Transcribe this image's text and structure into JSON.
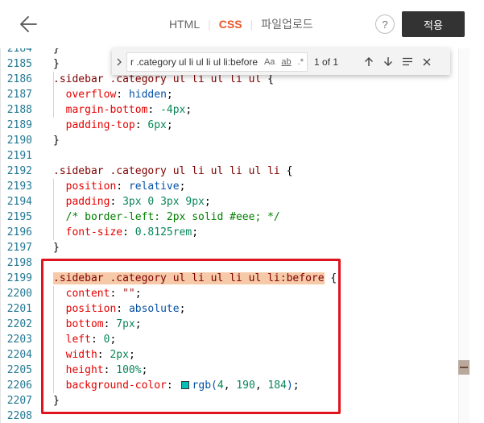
{
  "header": {
    "back_icon": "arrow-left-icon",
    "tabs": [
      {
        "label": "HTML",
        "active": false
      },
      {
        "label": "CSS",
        "active": true
      },
      {
        "label": "파일업로드",
        "active": false
      }
    ],
    "separator": "|",
    "help_label": "?",
    "apply_label": "적용"
  },
  "find": {
    "query": "r .category ul li ul li ul li:before",
    "match_case": "Aa",
    "whole_word": "ab",
    "regex": ".*",
    "count": "1 of 1",
    "icons": {
      "toggle": "chevron-right-icon",
      "prev": "arrow-up-icon",
      "next": "arrow-down-icon",
      "selection": "find-in-selection-icon",
      "close": "close-icon"
    }
  },
  "editor": {
    "colors": {
      "selector": "#800000",
      "property": "#e50000",
      "value": "#0451a5",
      "number": "#098658",
      "comment": "#008000",
      "line_number": "#237893",
      "highlight_box": "#e0141e",
      "swatch": "#04beb8"
    },
    "lines": [
      {
        "n": "2184",
        "tokens": [
          {
            "t": "}",
            "c": "punc"
          }
        ]
      },
      {
        "n": "2185",
        "tokens": [
          {
            "t": "}",
            "c": "punc"
          }
        ]
      },
      {
        "n": "2186",
        "tokens": [
          {
            "t": ".sidebar .category ul li ul li ul",
            "c": "sel"
          },
          {
            "t": " {",
            "c": "punc"
          }
        ]
      },
      {
        "n": "2187",
        "tokens": [
          {
            "t": "  "
          },
          {
            "t": "overflow",
            "c": "prop"
          },
          {
            "t": ": ",
            "c": "punc"
          },
          {
            "t": "hidden",
            "c": "val"
          },
          {
            "t": ";",
            "c": "punc"
          }
        ]
      },
      {
        "n": "2188",
        "tokens": [
          {
            "t": "  "
          },
          {
            "t": "margin-bottom",
            "c": "prop"
          },
          {
            "t": ": ",
            "c": "punc"
          },
          {
            "t": "-4px",
            "c": "num"
          },
          {
            "t": ";",
            "c": "punc"
          }
        ]
      },
      {
        "n": "2189",
        "tokens": [
          {
            "t": "  "
          },
          {
            "t": "padding-top",
            "c": "prop"
          },
          {
            "t": ": ",
            "c": "punc"
          },
          {
            "t": "6px",
            "c": "num"
          },
          {
            "t": ";",
            "c": "punc"
          }
        ]
      },
      {
        "n": "2190",
        "tokens": [
          {
            "t": "}",
            "c": "punc"
          }
        ]
      },
      {
        "n": "2191",
        "tokens": []
      },
      {
        "n": "2192",
        "tokens": [
          {
            "t": ".sidebar .category ul li ul li ul li",
            "c": "sel"
          },
          {
            "t": " {",
            "c": "punc"
          }
        ]
      },
      {
        "n": "2193",
        "tokens": [
          {
            "t": "  "
          },
          {
            "t": "position",
            "c": "prop"
          },
          {
            "t": ": ",
            "c": "punc"
          },
          {
            "t": "relative",
            "c": "val"
          },
          {
            "t": ";",
            "c": "punc"
          }
        ]
      },
      {
        "n": "2194",
        "tokens": [
          {
            "t": "  "
          },
          {
            "t": "padding",
            "c": "prop"
          },
          {
            "t": ": ",
            "c": "punc"
          },
          {
            "t": "3px 0 3px 9px",
            "c": "num"
          },
          {
            "t": ";",
            "c": "punc"
          }
        ]
      },
      {
        "n": "2195",
        "tokens": [
          {
            "t": "  "
          },
          {
            "t": "/* border-left: 2px solid #eee; */",
            "c": "cmt"
          }
        ]
      },
      {
        "n": "2196",
        "tokens": [
          {
            "t": "  "
          },
          {
            "t": "font-size",
            "c": "prop"
          },
          {
            "t": ": ",
            "c": "punc"
          },
          {
            "t": "0.8125rem",
            "c": "num"
          },
          {
            "t": ";",
            "c": "punc"
          }
        ]
      },
      {
        "n": "2197",
        "tokens": [
          {
            "t": "}",
            "c": "punc"
          }
        ]
      },
      {
        "n": "2198",
        "tokens": []
      },
      {
        "n": "2199",
        "tokens": [
          {
            "t": ".sidebar .category ul li ul li ul li:before",
            "c": "sel",
            "hl": true
          },
          {
            "t": " {",
            "c": "punc"
          }
        ]
      },
      {
        "n": "2200",
        "tokens": [
          {
            "t": "  "
          },
          {
            "t": "content",
            "c": "prop"
          },
          {
            "t": ": ",
            "c": "punc"
          },
          {
            "t": "\"\"",
            "c": "str"
          },
          {
            "t": ";",
            "c": "punc"
          }
        ]
      },
      {
        "n": "2201",
        "tokens": [
          {
            "t": "  "
          },
          {
            "t": "position",
            "c": "prop"
          },
          {
            "t": ": ",
            "c": "punc"
          },
          {
            "t": "absolute",
            "c": "val"
          },
          {
            "t": ";",
            "c": "punc"
          }
        ]
      },
      {
        "n": "2202",
        "tokens": [
          {
            "t": "  "
          },
          {
            "t": "bottom",
            "c": "prop"
          },
          {
            "t": ": ",
            "c": "punc"
          },
          {
            "t": "7px",
            "c": "num"
          },
          {
            "t": ";",
            "c": "punc"
          }
        ]
      },
      {
        "n": "2203",
        "tokens": [
          {
            "t": "  "
          },
          {
            "t": "left",
            "c": "prop"
          },
          {
            "t": ": ",
            "c": "punc"
          },
          {
            "t": "0",
            "c": "num"
          },
          {
            "t": ";",
            "c": "punc"
          }
        ]
      },
      {
        "n": "2204",
        "tokens": [
          {
            "t": "  "
          },
          {
            "t": "width",
            "c": "prop"
          },
          {
            "t": ": ",
            "c": "punc"
          },
          {
            "t": "2px",
            "c": "num"
          },
          {
            "t": ";",
            "c": "punc"
          }
        ]
      },
      {
        "n": "2205",
        "tokens": [
          {
            "t": "  "
          },
          {
            "t": "height",
            "c": "prop"
          },
          {
            "t": ": ",
            "c": "punc"
          },
          {
            "t": "100%",
            "c": "num"
          },
          {
            "t": ";",
            "c": "punc"
          }
        ]
      },
      {
        "n": "2206",
        "tokens": [
          {
            "t": "  "
          },
          {
            "t": "background-color",
            "c": "prop"
          },
          {
            "t": ": ",
            "c": "punc"
          },
          {
            "t": "",
            "c": "swatch"
          },
          {
            "t": "rgb(",
            "c": "val"
          },
          {
            "t": "4",
            "c": "num"
          },
          {
            "t": ", ",
            "c": "punc"
          },
          {
            "t": "190",
            "c": "num"
          },
          {
            "t": ", ",
            "c": "punc"
          },
          {
            "t": "184",
            "c": "num"
          },
          {
            "t": ")",
            "c": "val"
          },
          {
            "t": ";",
            "c": "punc"
          }
        ]
      },
      {
        "n": "2207",
        "tokens": [
          {
            "t": "}",
            "c": "punc"
          }
        ]
      },
      {
        "n": "2208",
        "tokens": []
      }
    ]
  }
}
